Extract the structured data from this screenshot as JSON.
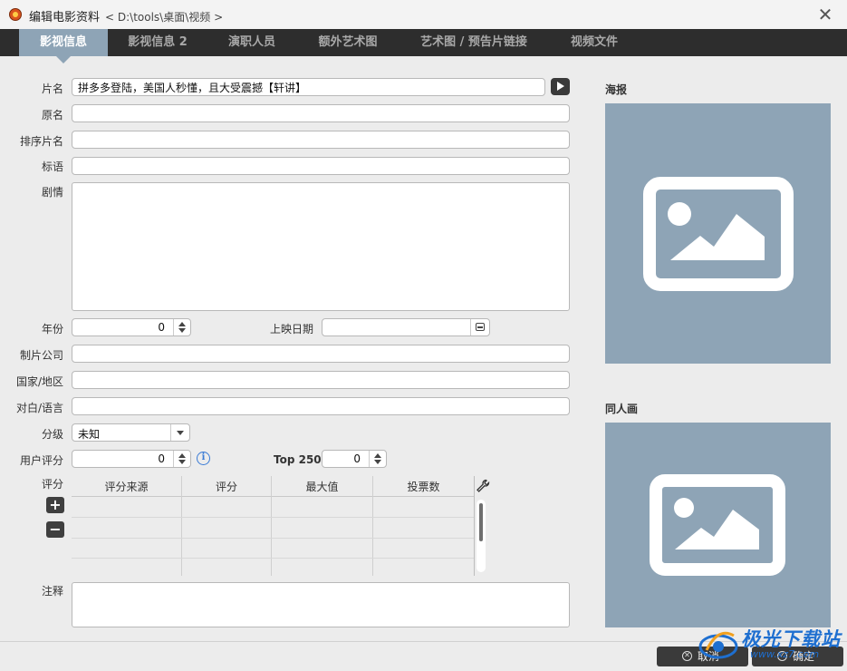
{
  "window": {
    "title": "编辑电影资料",
    "path": "< D:\\tools\\桌面\\视频 >",
    "close_symbol": "✕"
  },
  "tabs": [
    {
      "label": "影视信息",
      "active": true
    },
    {
      "label": "影视信息 2",
      "active": false
    },
    {
      "label": "演职人员",
      "active": false
    },
    {
      "label": "额外艺术图",
      "active": false
    },
    {
      "label": "艺术图 / 预告片链接",
      "active": false
    },
    {
      "label": "视频文件",
      "active": false
    }
  ],
  "form": {
    "title_label": "片名",
    "title_value": "拼多多登陆，美国人秒懂，且大受震撼【轩讲】",
    "original_label": "原名",
    "original_value": "",
    "sort_label": "排序片名",
    "sort_value": "",
    "tagline_label": "标语",
    "tagline_value": "",
    "plot_label": "剧情",
    "plot_value": "",
    "year_label": "年份",
    "year_value": "0",
    "release_label": "上映日期",
    "release_value": "",
    "studio_label": "制片公司",
    "studio_value": "",
    "country_label": "国家/地区",
    "country_value": "",
    "language_label": "对白/语言",
    "language_value": "",
    "rating_class_label": "分级",
    "rating_class_value": "未知",
    "user_rating_label": "用户评分",
    "user_rating_value": "0",
    "info_symbol": "i",
    "top250_label": "Top 250",
    "top250_value": "0",
    "ratings_label": "评分",
    "add_symbol": "+",
    "remove_symbol": "−",
    "notes_label": "注释",
    "notes_value": ""
  },
  "ratings_table": {
    "columns": [
      "评分来源",
      "评分",
      "最大值",
      "投票数"
    ],
    "rows": []
  },
  "side": {
    "poster_label": "海报",
    "fanart_label": "同人画"
  },
  "footer": {
    "cancel_label": "取消",
    "cancel_symbol": "✕",
    "ok_label": "确定",
    "ok_symbol": "✓"
  },
  "watermark": {
    "text": "极光下载站",
    "url": "www.xz7.com"
  },
  "colors": {
    "accent": "#8ea4b6",
    "tabbar": "#2d2d2d",
    "background": "#ececec",
    "info": "#3a7bd5",
    "watermark": "#1e6fd0"
  }
}
